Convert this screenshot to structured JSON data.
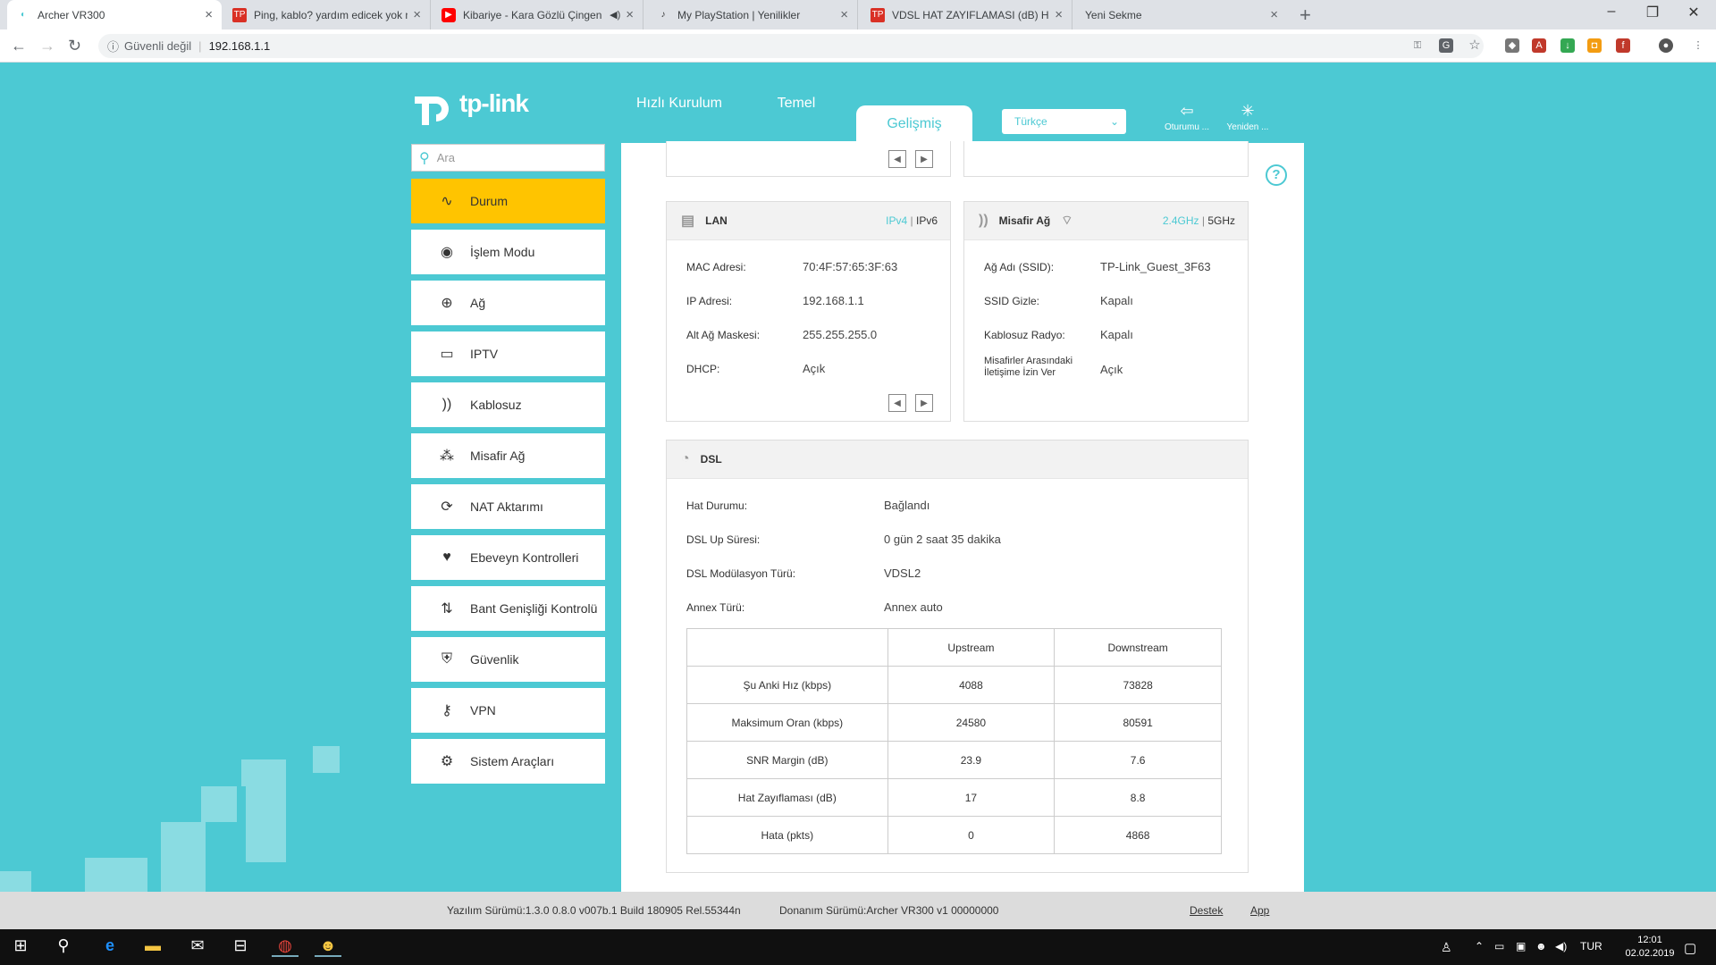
{
  "browser": {
    "tabs": [
      {
        "title": "Archer VR300",
        "icon": "tp-link-icon",
        "active": true
      },
      {
        "title": "Ping, kablo? yardım edicek yok m",
        "icon": "technopat-icon"
      },
      {
        "title": "Kibariye - Kara Gözlü Çingen",
        "icon": "youtube-icon"
      },
      {
        "title": "My PlayStation | Yenilikler",
        "icon": "playstation-icon"
      },
      {
        "title": "VDSL HAT ZAYIFLAMASI (dB) HE",
        "icon": "technopat-icon"
      },
      {
        "title": "Yeni Sekme",
        "icon": ""
      }
    ],
    "address": {
      "security": "Güvenli değil",
      "url": "192.168.1.1"
    }
  },
  "header": {
    "brand": "tp-link",
    "nav": [
      "Hızlı Kurulum",
      "Temel",
      "Gelişmiş"
    ],
    "language": "Türkçe",
    "logout": "Oturumu ...",
    "reboot": "Yeniden ..."
  },
  "sidebar": {
    "search_placeholder": "Ara",
    "items": [
      {
        "label": "Durum",
        "icon": "pulse-icon"
      },
      {
        "label": "İşlem Modu",
        "icon": "toggle-icon"
      },
      {
        "label": "Ağ",
        "icon": "globe-icon"
      },
      {
        "label": "IPTV",
        "icon": "monitor-icon"
      },
      {
        "label": "Kablosuz",
        "icon": "wifi-icon"
      },
      {
        "label": "Misafir Ağ",
        "icon": "guests-icon"
      },
      {
        "label": "NAT Aktarımı",
        "icon": "nat-icon"
      },
      {
        "label": "Ebeveyn Kontrolleri",
        "icon": "heart-icon"
      },
      {
        "label": "Bant Genişliği Kontrolü",
        "icon": "arrows-icon"
      },
      {
        "label": "Güvenlik",
        "icon": "shield-icon"
      },
      {
        "label": "VPN",
        "icon": "key-icon"
      },
      {
        "label": "Sistem Araçları",
        "icon": "gear-icon"
      }
    ]
  },
  "lan": {
    "title": "LAN",
    "ipv4": "IPv4",
    "ipv6": "IPv6",
    "rows": [
      {
        "label": "MAC Adresi:",
        "value": "70:4F:57:65:3F:63"
      },
      {
        "label": "IP Adresi:",
        "value": "192.168.1.1"
      },
      {
        "label": "Alt Ağ Maskesi:",
        "value": "255.255.255.0"
      },
      {
        "label": "DHCP:",
        "value": "Açık"
      }
    ]
  },
  "guest": {
    "title": "Misafir Ağ",
    "band24": "2.4GHz",
    "band5": "5GHz",
    "rows": [
      {
        "label": "Ağ Adı (SSID):",
        "value": "TP-Link_Guest_3F63"
      },
      {
        "label": "SSID Gizle:",
        "value": "Kapalı"
      },
      {
        "label": "Kablosuz Radyo:",
        "value": "Kapalı"
      },
      {
        "label": "Misafirler Arasındaki İletişime İzin Ver",
        "value": "Açık"
      }
    ]
  },
  "dsl": {
    "title": "DSL",
    "rows": [
      {
        "label": "Hat Durumu:",
        "value": "Bağlandı"
      },
      {
        "label": "DSL Up Süresi:",
        "value": "0 gün 2 saat 35 dakika"
      },
      {
        "label": "DSL Modülasyon Türü:",
        "value": "VDSL2"
      },
      {
        "label": "Annex Türü:",
        "value": "Annex auto"
      }
    ],
    "table": {
      "headers": [
        "",
        "Upstream",
        "Downstream"
      ],
      "rows": [
        [
          "Şu Anki Hız (kbps)",
          "4088",
          "73828"
        ],
        [
          "Maksimum Oran (kbps)",
          "24580",
          "80591"
        ],
        [
          "SNR Margin (dB)",
          "23.9",
          "7.6"
        ],
        [
          "Hat Zayıflaması (dB)",
          "17",
          "8.8"
        ],
        [
          "Hata (pkts)",
          "0",
          "4868"
        ]
      ]
    }
  },
  "footer": {
    "firmware": "Yazılım Sürümü:1.3.0 0.8.0 v007b.1 Build 180905 Rel.55344n",
    "hardware": "Donanım Sürümü:Archer VR300 v1 00000000",
    "support": "Destek",
    "app": "App"
  },
  "taskbar": {
    "lang": "TUR",
    "time": "12:01",
    "date": "02.02.2019"
  },
  "colors": {
    "accent": "#4cc9d3",
    "active_menu": "#ffc400"
  }
}
